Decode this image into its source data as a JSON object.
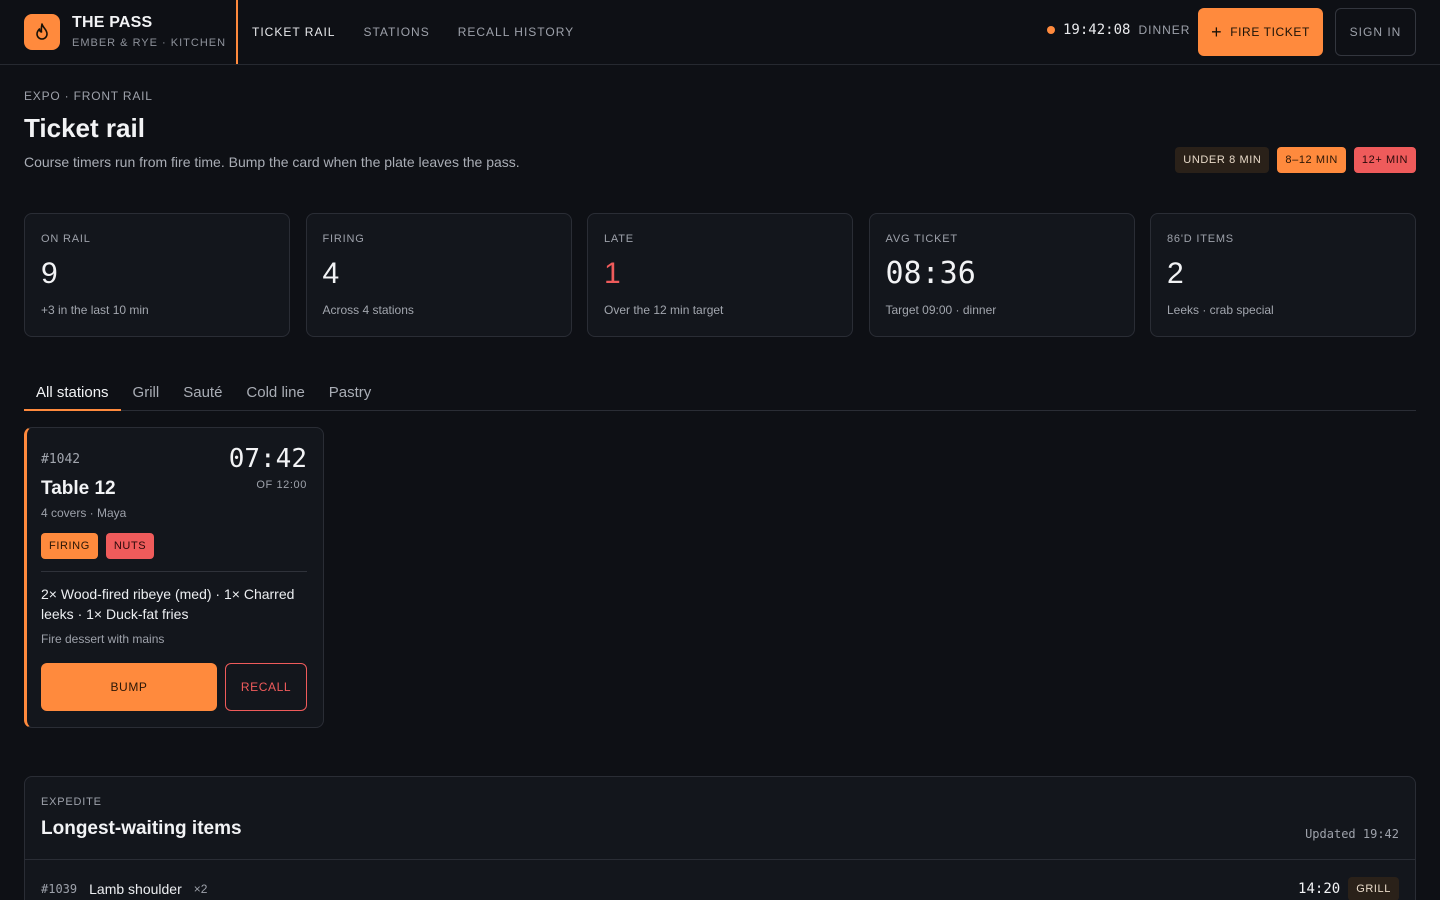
{
  "header": {
    "brand_name": "THE PASS",
    "brand_sub": "EMBER & RYE · KITCHEN",
    "nav": [
      {
        "label": "TICKET RAIL",
        "active": true
      },
      {
        "label": "STATIONS",
        "active": false
      },
      {
        "label": "RECALL HISTORY",
        "active": false
      }
    ],
    "clock_time": "19:42:08",
    "service": "DINNER",
    "fire_label": "FIRE TICKET",
    "signin_label": "SIGN IN"
  },
  "page": {
    "eyebrow": "EXPO · FRONT RAIL",
    "title": "Ticket rail",
    "description": "Course timers run from fire time. Bump the card when the plate leaves the pass.",
    "legend": [
      "UNDER 8 MIN",
      "8–12 MIN",
      "12+ MIN"
    ]
  },
  "stats": [
    {
      "label": "ON RAIL",
      "value": "9",
      "note": "+3 in the last 10 min"
    },
    {
      "label": "FIRING",
      "value": "4",
      "note": "Across 4 stations"
    },
    {
      "label": "LATE",
      "value": "1",
      "note": "Over the 12 min target"
    },
    {
      "label": "AVG TICKET",
      "value": "08:36",
      "note": "Target 09:00 · dinner"
    },
    {
      "label": "86'D ITEMS",
      "value": "2",
      "note": "Leeks · crab special"
    }
  ],
  "tabs": [
    "All stations",
    "Grill",
    "Sauté",
    "Cold line",
    "Pastry"
  ],
  "ticket": {
    "number": "#1042",
    "table": "Table 12",
    "meta": "4 covers · Maya",
    "timer": "07:42",
    "target": "OF 12:00",
    "tags": [
      "FIRING",
      "NUTS"
    ],
    "items": "2× Wood-fired ribeye (med) · 1× Charred leeks · 1× Duck-fat fries",
    "note": "Fire dessert with mains",
    "bump_label": "BUMP",
    "recall_label": "RECALL"
  },
  "expedite": {
    "eyebrow": "EXPEDITE",
    "title": "Longest-waiting items",
    "updated": "Updated 19:42",
    "rows": [
      {
        "ticket": "#1039",
        "item": "Lamb shoulder",
        "qty": "×2",
        "time": "14:20",
        "station": "GRILL"
      }
    ]
  },
  "colors": {
    "accent": "#ff8a3d",
    "danger": "#ef5b5b",
    "background": "#0e1015",
    "card": "#13161c"
  }
}
